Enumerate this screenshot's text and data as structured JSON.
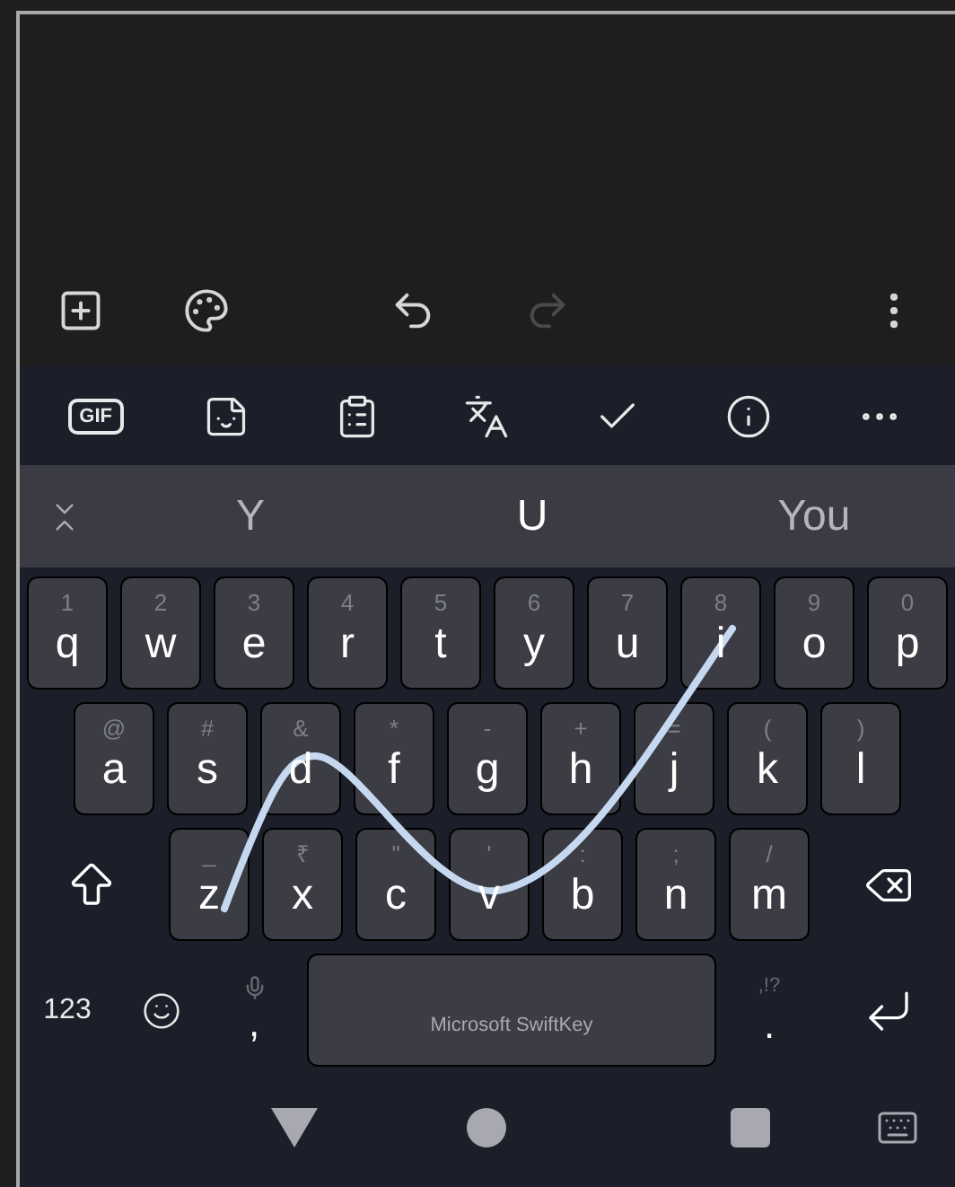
{
  "app_toolbar": [
    {
      "kind": "add",
      "disabled": false
    },
    {
      "kind": "palette",
      "disabled": false
    },
    {
      "kind": "undo",
      "disabled": false
    },
    {
      "kind": "redo",
      "disabled": true
    },
    {
      "kind": "more",
      "disabled": false
    }
  ],
  "keyboard_toolbar": [
    {
      "kind": "gif",
      "label": "GIF"
    },
    {
      "kind": "sticker"
    },
    {
      "kind": "clipboard"
    },
    {
      "kind": "translate"
    },
    {
      "kind": "check"
    },
    {
      "kind": "info"
    },
    {
      "kind": "more"
    }
  ],
  "suggestions": [
    {
      "text": "Y",
      "selected": false
    },
    {
      "text": "U",
      "selected": true
    },
    {
      "text": "You",
      "selected": false
    }
  ],
  "rows": [
    [
      {
        "letter": "q",
        "hint": "1"
      },
      {
        "letter": "w",
        "hint": "2"
      },
      {
        "letter": "e",
        "hint": "3"
      },
      {
        "letter": "r",
        "hint": "4"
      },
      {
        "letter": "t",
        "hint": "5"
      },
      {
        "letter": "y",
        "hint": "6"
      },
      {
        "letter": "u",
        "hint": "7"
      },
      {
        "letter": "i",
        "hint": "8"
      },
      {
        "letter": "o",
        "hint": "9"
      },
      {
        "letter": "p",
        "hint": "0"
      }
    ],
    [
      {
        "letter": "a",
        "hint": "@"
      },
      {
        "letter": "s",
        "hint": "#"
      },
      {
        "letter": "d",
        "hint": "&"
      },
      {
        "letter": "f",
        "hint": "*"
      },
      {
        "letter": "g",
        "hint": "-"
      },
      {
        "letter": "h",
        "hint": "+"
      },
      {
        "letter": "j",
        "hint": "="
      },
      {
        "letter": "k",
        "hint": "("
      },
      {
        "letter": "l",
        "hint": ")"
      }
    ],
    [
      {
        "letter": "z",
        "hint": "_"
      },
      {
        "letter": "x",
        "hint": "₹"
      },
      {
        "letter": "c",
        "hint": "\""
      },
      {
        "letter": "v",
        "hint": "'"
      },
      {
        "letter": "b",
        "hint": ":"
      },
      {
        "letter": "n",
        "hint": ";"
      },
      {
        "letter": "m",
        "hint": "/"
      }
    ]
  ],
  "bottom_row": {
    "numbers": "123",
    "comma": ",",
    "space": "Microsoft SwiftKey",
    "period": ".",
    "period_hint": ",!?"
  }
}
